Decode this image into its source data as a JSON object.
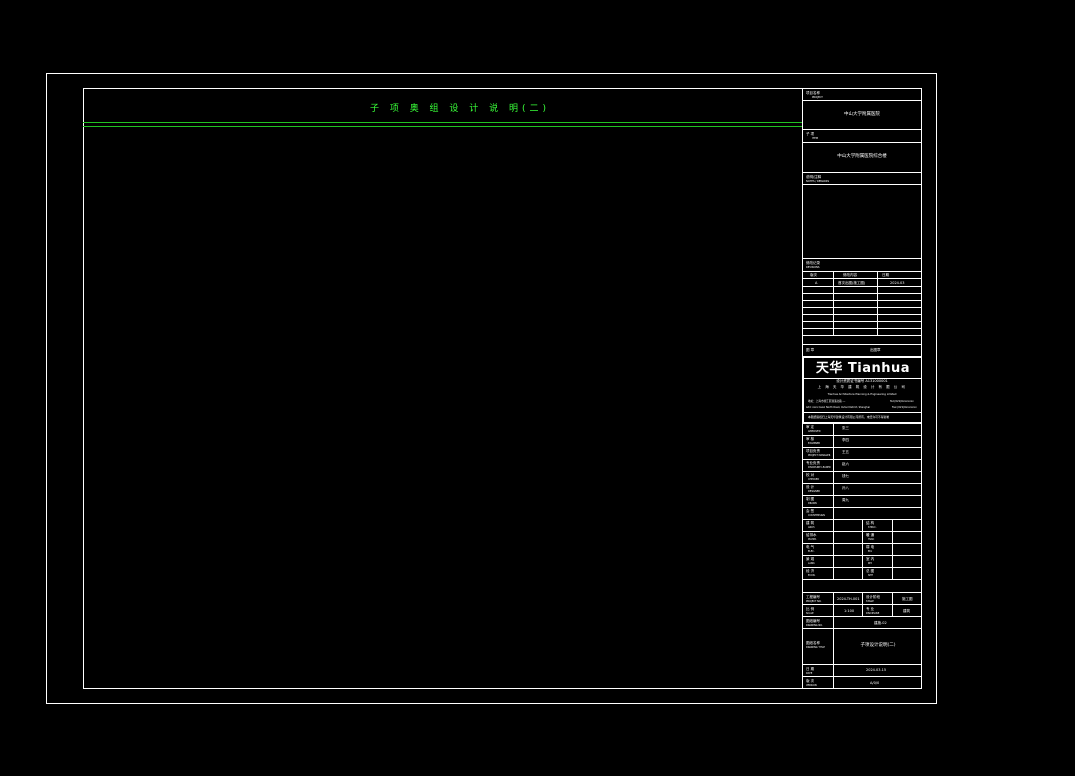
{
  "drawing": {
    "sheet_title": "子 项 奥 组 设 计 说 明(二)",
    "line_color": "#22c222",
    "title_color": "#39ff39"
  },
  "title_block": {
    "project_label": "项目名称",
    "project_label_en": "PROJECT",
    "project_name": "中山大学附属医院",
    "sub_item_label": "子 项",
    "sub_item_label_en": "ITEM",
    "sub_item_name": "中山大学附属医院综合楼",
    "notes_label": "说明/注释",
    "notes_label_en": "NOTES / REMARKS",
    "revision_label": "修改记录",
    "revision_label_en": "REVISIONS",
    "revision_headers": [
      "版次",
      "修改内容",
      "日期"
    ],
    "revision_first_row": [
      "A",
      "首次出图(施工图)",
      "2024.03"
    ],
    "seal_label": "图 章",
    "seal_value": "出图章",
    "company_logo": "天华 Tianhua",
    "company_cert": "设计资质证书编号 A131000001",
    "company_name": "上 海 天 华 建 筑 设 计 有 限 公 司",
    "company_name_en": "Tianhua Architecture Planning & Engineering Limited",
    "address_line1": "地址：上海市徐汇区漕溪北路 ---",
    "address_line1_right": "Tel:(021)6xxxxxxx",
    "address_line2": "Add: xxxx Caoxi North Road, Xuhui District, Shanghai",
    "address_line2_right": "Fax:(021)6xxxxxxx",
    "company_note": "本图纸版权归上海天华建筑设计有限公司所有，未经许可不得复制",
    "signature_rows": [
      {
        "label": "审 定",
        "label_en": "APPROVED",
        "value": "张三"
      },
      {
        "label": "审 核",
        "label_en": "EXAMINED",
        "value": "李四"
      },
      {
        "label": "项目负责",
        "label_en": "PROJECT MANAGER",
        "value": "王五"
      },
      {
        "label": "专业负责",
        "label_en": "DISCIPLINE LEADER",
        "value": "赵六"
      },
      {
        "label": "校 对",
        "label_en": "CHECKED",
        "value": "钱七"
      },
      {
        "label": "设 计",
        "label_en": "DESIGNED",
        "value": "孙八"
      },
      {
        "label": "制 图",
        "label_en": "DRAWN",
        "value": "周九"
      },
      {
        "label": "会 签",
        "label_en": "COUNTERSIGN",
        "value": ""
      }
    ],
    "countersign_rows": [
      {
        "left": "建 筑",
        "left_en": "ARCH.",
        "right": "结 构",
        "right_en": "STRUC."
      },
      {
        "left": "给排水",
        "left_en": "PLUMB.",
        "right": "暖 通",
        "right_en": "HVAC"
      },
      {
        "left": "电 气",
        "left_en": "ELEC.",
        "right": "弱 电",
        "right_en": "ELV"
      },
      {
        "left": "景 观",
        "left_en": "LAND.",
        "right": "室 内",
        "right_en": "INT."
      },
      {
        "left": "经 济",
        "left_en": "ECON.",
        "right": "总 图",
        "right_en": "SITE"
      }
    ],
    "project_no_label": "工程编号",
    "project_no_label_en": "PROJECT NO.",
    "project_no": "2024-TH-001",
    "stage_label": "设计阶段",
    "stage_label_en": "STAGE",
    "stage": "施工图",
    "scale_label": "比 例",
    "scale_label_en": "SCALE",
    "scale": "1:100",
    "discipline_label": "专 业",
    "discipline_label_en": "DISCIPLINE",
    "discipline": "建筑",
    "sheet_no_label": "图纸编号",
    "sheet_no_label_en": "DRAWING NO.",
    "sheet_no": "建施-02",
    "drawing_title_label": "图纸名称",
    "drawing_title_label_en": "DRAWING TITLE",
    "drawing_title": "子项设计说明(二)",
    "date_label": "日 期",
    "date_label_en": "DATE",
    "date": "2024.03.15",
    "version_label": "版 次",
    "version_label_en": "VERSION",
    "version": "A/0/0"
  }
}
